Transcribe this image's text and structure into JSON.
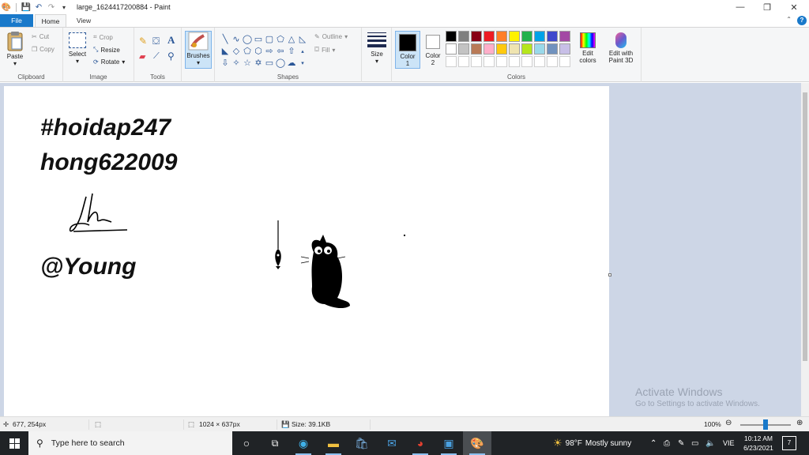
{
  "window": {
    "title": "large_1624417200884 - Paint",
    "controls": {
      "minimize": "—",
      "maximize": "❐",
      "close": "✕"
    }
  },
  "tabs": [
    {
      "label": "File"
    },
    {
      "label": "Home"
    },
    {
      "label": "View"
    }
  ],
  "ribbon": {
    "clipboard": {
      "group_label": "Clipboard",
      "paste": "Paste",
      "cut": "Cut",
      "copy": "Copy"
    },
    "image": {
      "group_label": "Image",
      "select": "Select",
      "crop": "Crop",
      "resize": "Resize",
      "rotate": "Rotate"
    },
    "tools": {
      "group_label": "Tools"
    },
    "brushes": {
      "label": "Brushes"
    },
    "shapes": {
      "group_label": "Shapes",
      "outline": "Outline",
      "fill": "Fill"
    },
    "size": {
      "label": "Size"
    },
    "colors": {
      "group_label": "Colors",
      "color1_label": "Color",
      "color1_num": "1",
      "color2_label": "Color",
      "color2_num": "2",
      "edit_colors_line1": "Edit",
      "edit_colors_line2": "colors",
      "paint3d_line1": "Edit with",
      "paint3d_line2": "Paint 3D",
      "color1_value": "#000000",
      "color2_value": "#ffffff",
      "palette_row1": [
        "#000000",
        "#7f7f7f",
        "#880015",
        "#ed1c24",
        "#ff7f27",
        "#fff200",
        "#22b14c",
        "#00a2e8",
        "#3f48cc",
        "#a349a4"
      ],
      "palette_row2": [
        "#ffffff",
        "#c3c3c3",
        "#b97a57",
        "#ffaec9",
        "#ffc90e",
        "#efe4b0",
        "#b5e61d",
        "#99d9ea",
        "#7092be",
        "#c8bfe7"
      ]
    }
  },
  "canvas": {
    "line1": "#hoidap247",
    "line2": "hong622009",
    "line3": "@Young"
  },
  "watermark": {
    "title": "Activate Windows",
    "subtitle": "Go to Settings to activate Windows."
  },
  "status": {
    "cursor_pos": "677, 254px",
    "image_size": "1024 × 637px",
    "file_size": "Size: 39.1KB",
    "zoom": "100%"
  },
  "taskbar": {
    "search_placeholder": "Type here to search",
    "weather_temp": "98°F",
    "weather_text": "Mostly sunny",
    "language": "VIE",
    "time": "10:12 AM",
    "date": "6/23/2021",
    "notifications": "7"
  }
}
